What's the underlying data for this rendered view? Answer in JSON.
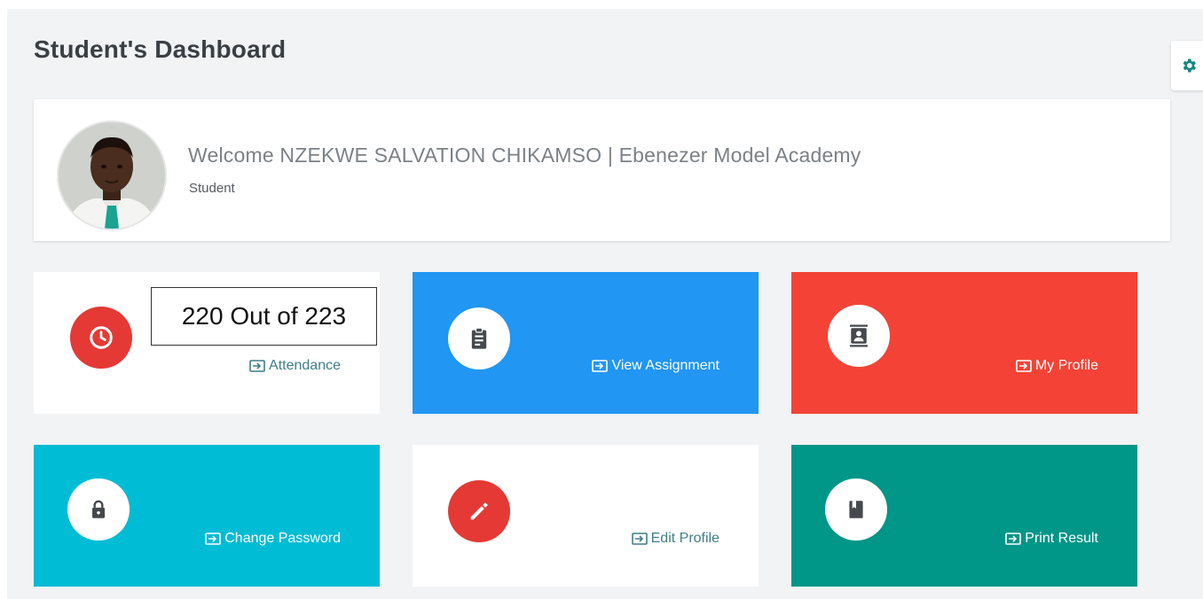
{
  "page": {
    "title": "Student's Dashboard"
  },
  "settings": {
    "icon": "gear-icon"
  },
  "welcome": {
    "message": "Welcome NZEKWE SALVATION CHIKAMSO | Ebenezer Model Academy",
    "role": "Student"
  },
  "attendance": {
    "count_text": "220 Out of 223"
  },
  "tiles": [
    {
      "label": "Attendance",
      "icon": "clock-icon",
      "color": "#ffffff",
      "accent": "#e53935"
    },
    {
      "label": "View Assignment",
      "icon": "clipboard-icon",
      "color": "#2196f3"
    },
    {
      "label": "My Profile",
      "icon": "contact-book-icon",
      "color": "#f44336"
    },
    {
      "label": "Change Password",
      "icon": "lock-icon",
      "color": "#00bcd4"
    },
    {
      "label": "Edit Profile",
      "icon": "pencil-icon",
      "color": "#ffffff",
      "accent": "#e53935"
    },
    {
      "label": "Print Result",
      "icon": "book-icon",
      "color": "#009688"
    }
  ],
  "colors": {
    "background": "#f1f3f5",
    "link_teal": "#3f7f86",
    "settings_icon": "#0f8a7b"
  }
}
